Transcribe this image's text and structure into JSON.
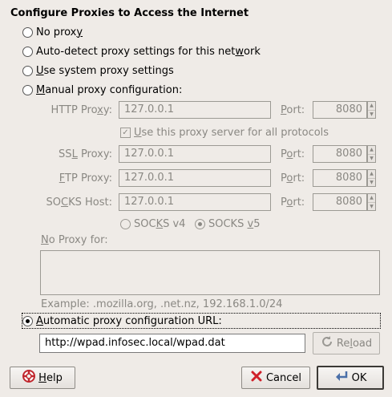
{
  "title": "Configure Proxies to Access the Internet",
  "options": {
    "no_proxy": {
      "pre": "No prox",
      "key": "y",
      "post": ""
    },
    "auto_detect": {
      "pre": "Auto-detect proxy settings for this net",
      "key": "w",
      "post": "ork"
    },
    "system": {
      "pre": "",
      "key": "U",
      "post": "se system proxy settings"
    },
    "manual": {
      "pre": "",
      "key": "M",
      "post": "anual proxy configuration:"
    },
    "automatic": {
      "pre": "",
      "key": "A",
      "post": "utomatic proxy configuration URL:"
    }
  },
  "manual": {
    "http": {
      "pre": "HTTP Pro",
      "key": "x",
      "post": "y:",
      "host": "127.0.0.1",
      "port": "8080"
    },
    "use_all": {
      "pre": "",
      "key": "U",
      "post": "se this proxy server for all protocols",
      "checked": true
    },
    "ssl": {
      "pre": "SS",
      "key": "L",
      "post": " Proxy:",
      "host": "127.0.0.1",
      "port": "8080"
    },
    "ftp": {
      "pre": "",
      "key": "F",
      "post": "TP Proxy:",
      "host": "127.0.0.1",
      "port": "8080"
    },
    "socks": {
      "pre": "SO",
      "key": "C",
      "post": "KS Host:",
      "host": "127.0.0.1",
      "port": "8080"
    },
    "port_label": {
      "pre": "",
      "key": "P",
      "post": "ort:"
    },
    "port_label_o": {
      "pre": "P",
      "key": "o",
      "post": "rt:"
    },
    "socks_v4": {
      "pre": "SOC",
      "key": "K",
      "post": "S v4"
    },
    "socks_v5": {
      "pre": "SOCKS ",
      "key": "v",
      "post": "5"
    },
    "no_proxy_label": {
      "pre": "",
      "key": "N",
      "post": "o Proxy for:"
    },
    "no_proxy_value": "",
    "example": "Example: .mozilla.org, .net.nz, 192.168.1.0/24"
  },
  "auto_url": "http://wpad.infosec.local/wpad.dat",
  "buttons": {
    "reload": {
      "pre": "Re",
      "key": "l",
      "post": "oad"
    },
    "help": {
      "pre": "",
      "key": "H",
      "post": "elp"
    },
    "cancel": "Cancel",
    "ok": "OK"
  }
}
